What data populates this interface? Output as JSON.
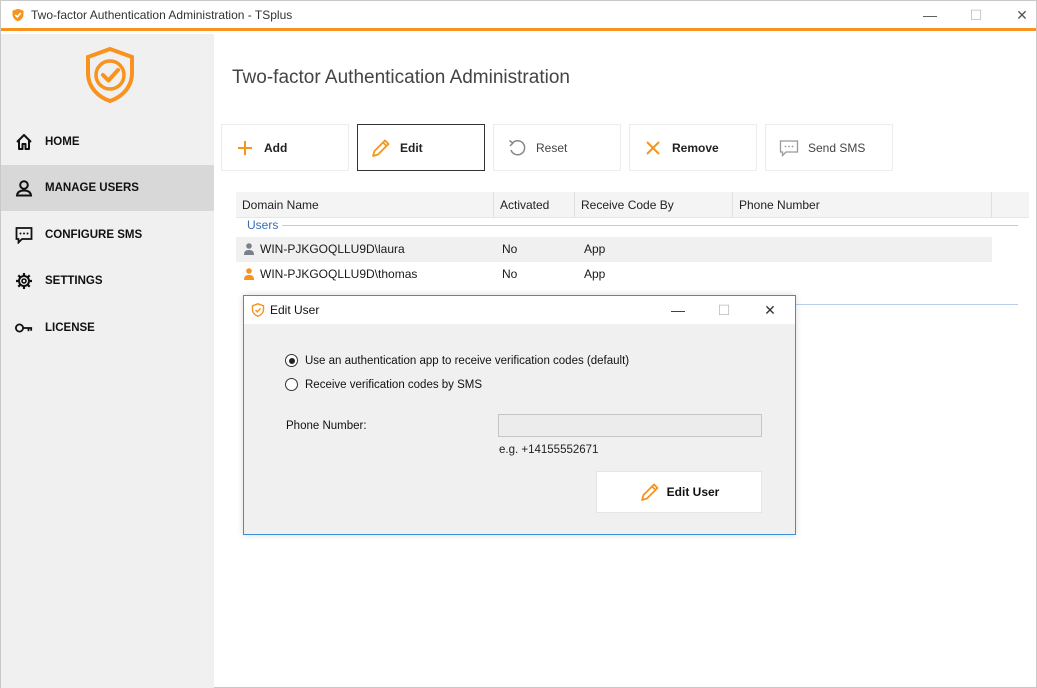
{
  "window": {
    "title": "Two-factor Authentication Administration - TSplus",
    "controls": {
      "minimize": "—",
      "maximize": "☐",
      "close": "✕"
    }
  },
  "colors": {
    "accent": "#f7931e",
    "link_blue": "#2f6fb6",
    "dialog_border": "#3b8fd8"
  },
  "sidebar": {
    "items": [
      {
        "label": "HOME",
        "icon": "home-icon"
      },
      {
        "label": "MANAGE USERS",
        "icon": "user-icon",
        "active": true
      },
      {
        "label": "CONFIGURE SMS",
        "icon": "message-icon"
      },
      {
        "label": "SETTINGS",
        "icon": "gear-icon"
      },
      {
        "label": "LICENSE",
        "icon": "key-icon"
      }
    ]
  },
  "main": {
    "title": "Two-factor Authentication Administration"
  },
  "toolbar": {
    "add": "Add",
    "edit": "Edit",
    "reset": "Reset",
    "remove": "Remove",
    "send_sms": "Send SMS"
  },
  "grid": {
    "columns": [
      "Domain Name",
      "Activated",
      "Receive Code By",
      "Phone Number"
    ],
    "group": "Users",
    "rows": [
      {
        "domain": "WIN-PJKGOQLLU9D\\laura",
        "activated": "No",
        "receive_by": "App",
        "phone": ""
      },
      {
        "domain": "WIN-PJKGOQLLU9D\\thomas",
        "activated": "No",
        "receive_by": "App",
        "phone": ""
      }
    ]
  },
  "dialog": {
    "title": "Edit User",
    "controls": {
      "minimize": "—",
      "maximize": "☐",
      "close": "✕"
    },
    "option_app": "Use an authentication app to receive verification codes (default)",
    "option_sms": "Receive verification codes by SMS",
    "phone_label": "Phone Number:",
    "phone_value": "",
    "phone_hint": "e.g. +14155552671",
    "submit": "Edit User"
  }
}
